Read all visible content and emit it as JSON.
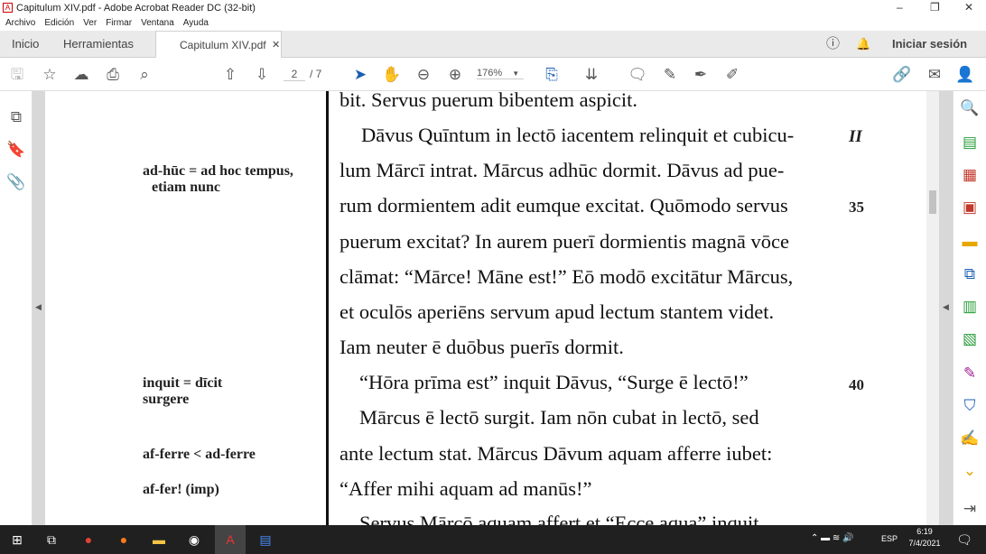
{
  "window": {
    "title": "Capitulum XIV.pdf - Adobe Acrobat Reader DC (32-bit)"
  },
  "menu": [
    "Archivo",
    "Edición",
    "Ver",
    "Firmar",
    "Ventana",
    "Ayuda"
  ],
  "tabs": {
    "home": "Inicio",
    "tools": "Herramientas",
    "doc": "Capitulum XIV.pdf",
    "signin": "Iniciar sesión"
  },
  "toolbar": {
    "page_current": "2",
    "page_total": "/ 7",
    "zoom": "176%"
  },
  "page": {
    "lines": [
      "bit. Servus puerum bibentem aspicit.",
      "Dāvus Quīntum in lectō iacentem relinquit et cubicu-",
      "lum Mārcī intrat. Mārcus adhūc dormit. Dāvus ad pue-",
      "rum dormientem adit eumque excitat. Quōmodo servus",
      "puerum excitat? In aurem puerī dormientis magnā vōce",
      "clāmat: “Mārce! Māne est!” Eō modō excitātur Mārcus,",
      "et oculōs aperiēns servum apud lectum stantem videt.",
      "Iam neuter ē duōbus puerīs dormit.",
      "“Hōra prīma est” inquit Dāvus, “Surge ē lectō!”",
      "Mārcus ē lectō surgit. Iam nōn cubat in lectō, sed",
      "ante lectum stat. Mārcus Dāvum aquam afferre iubet:",
      "“Affer mihi aquam ad manūs!”",
      "Servus Mārcō aquam affert et “Ecce aqua” inquit."
    ],
    "notes": [
      [
        "ad-hūc = ad hoc tempus,",
        "etiam nunc"
      ],
      [
        "inquit = dīcit",
        "surgere"
      ],
      [
        "af-ferre < ad-ferre"
      ],
      [
        "af-fer! (imp)"
      ]
    ],
    "line_numbers": [
      "II",
      "35",
      "40"
    ]
  },
  "taskbar": {
    "lang": "ESP",
    "time": "6:19",
    "date": "7/4/2021"
  }
}
